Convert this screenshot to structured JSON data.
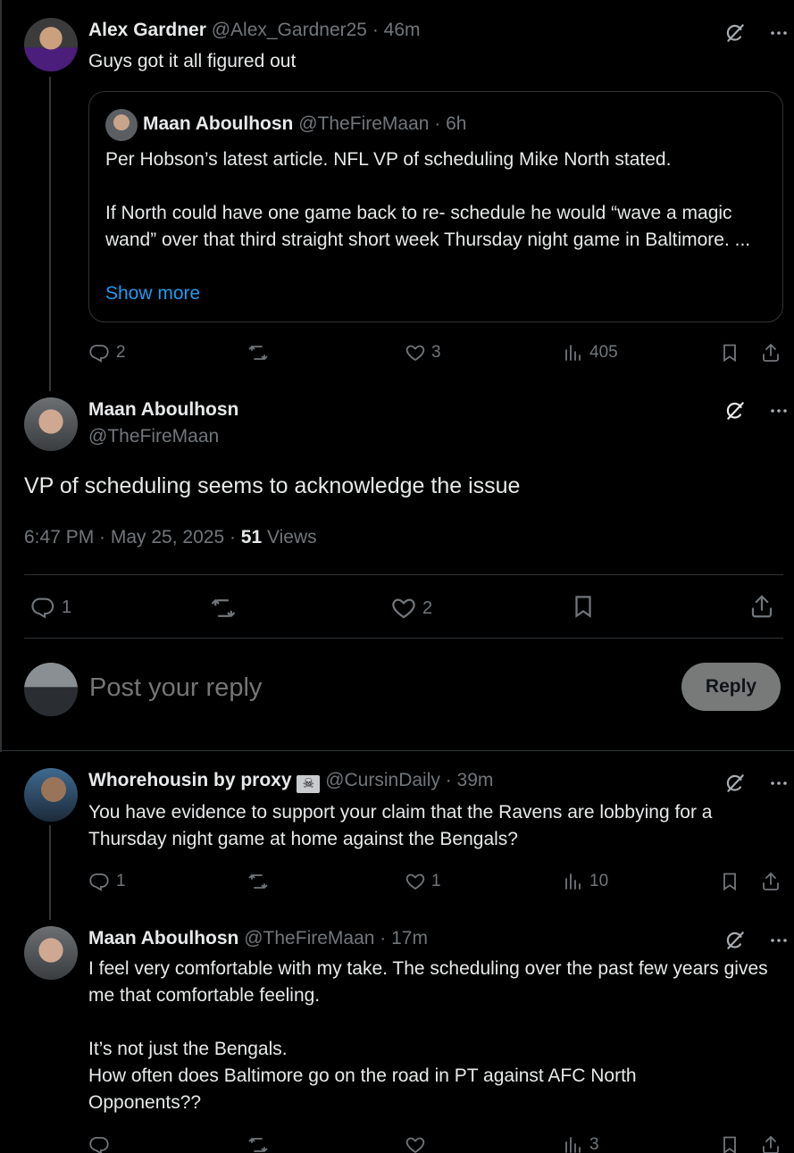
{
  "post1": {
    "name": "Alex Gardner",
    "handle": "@Alex_Gardner25",
    "time": "· 46m",
    "text": "Guys got it all figured out",
    "quote": {
      "name": "Maan Aboulhosn",
      "handle": "@TheFireMaan",
      "time": "· 6h",
      "line1": "Per Hobson’s latest article. NFL VP of scheduling Mike North stated.",
      "line2": "If North could have one game back to re- schedule he would “wave a magic wand” over that third straight short week Thursday night game in Baltimore. ...",
      "show_more": "Show more"
    },
    "replies": "2",
    "likes": "3",
    "views": "405"
  },
  "main": {
    "name": "Maan Aboulhosn",
    "handle": "@TheFireMaan",
    "text": "VP of scheduling seems to acknowledge the issue",
    "timestamp": "6:47 PM · May 25, 2025 · ",
    "views_count": "51",
    "views_label": " Views",
    "replies": "1",
    "likes": "2"
  },
  "composer": {
    "placeholder": "Post your reply",
    "button": "Reply"
  },
  "reply1": {
    "name": "Whorehousin by proxy",
    "handle": "@CursinDaily",
    "time": "· 39m",
    "text": "You have evidence to support your claim that the Ravens are lobbying for a Thursday night game at home against the Bengals?",
    "replies": "1",
    "likes": "1",
    "views": "10"
  },
  "reply2": {
    "name": "Maan Aboulhosn",
    "handle": "@TheFireMaan",
    "time": "· 17m",
    "p1": "I feel very comfortable with my take. The scheduling over the past few years gives me that comfortable feeling.",
    "p2": "It’s not just the Bengals.",
    "p3": "How often does Baltimore go on the road in PT against AFC North Opponents??",
    "views": "3"
  },
  "colors": {
    "link": "#1d9bf0",
    "muted": "#71767b",
    "border": "#2f3336"
  }
}
